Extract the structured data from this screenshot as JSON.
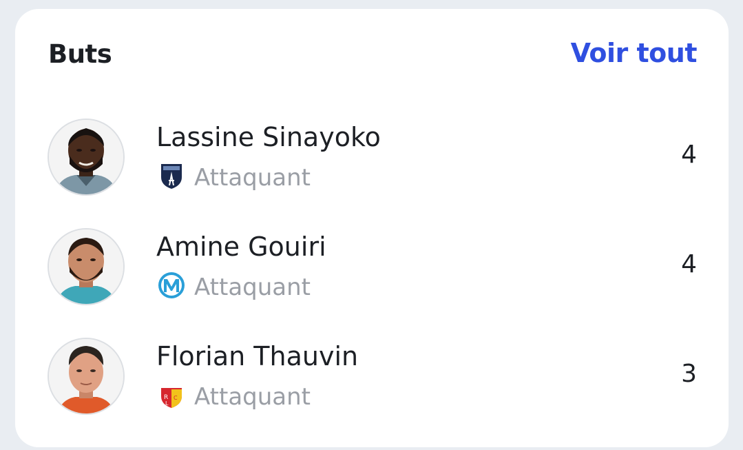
{
  "header": {
    "title": "Buts",
    "see_all": "Voir tout"
  },
  "players": [
    {
      "name": "Lassine Sinayoko",
      "position": "Attaquant",
      "goals": "4",
      "club_logo": "paris-fc-crest-icon"
    },
    {
      "name": "Amine Gouiri",
      "position": "Attaquant",
      "goals": "4",
      "club_logo": "olympique-marseille-crest-icon"
    },
    {
      "name": "Florian Thauvin",
      "position": "Attaquant",
      "goals": "3",
      "club_logo": "rc-lens-crest-icon"
    }
  ],
  "colors": {
    "accent": "#2f4fe0",
    "text": "#1c1f24",
    "muted": "#9a9ea5",
    "background": "#e9edf2",
    "card": "#ffffff"
  }
}
